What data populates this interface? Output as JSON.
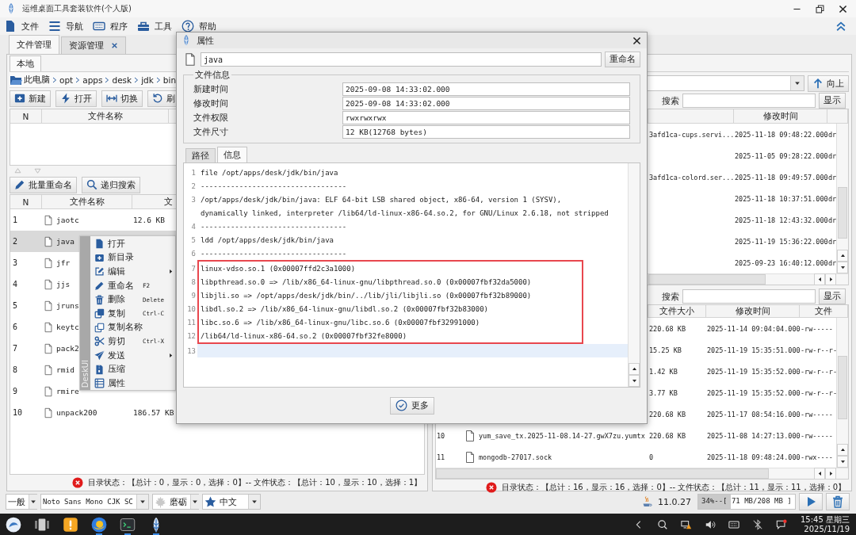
{
  "window": {
    "title": "运维桌面工具套装软件(个人版)"
  },
  "menu": [
    {
      "label": "文件",
      "kind": "docfill"
    },
    {
      "label": "导航",
      "kind": "list"
    },
    {
      "label": "程序",
      "kind": "keyboard"
    },
    {
      "label": "工具",
      "kind": "toolbox"
    },
    {
      "label": "帮助",
      "kind": "help"
    }
  ],
  "left_panel": {
    "tabs": [
      {
        "label": "文件管理",
        "selected": true,
        "closable": false
      },
      {
        "label": "资源管理",
        "selected": false,
        "closable": true
      }
    ],
    "subtabs": [
      {
        "label": "本地",
        "selected": true
      }
    ],
    "breadcrumb": [
      "此电脑",
      "opt",
      "apps",
      "desk",
      "jdk",
      "bin"
    ],
    "toolbar": [
      {
        "label": "新建",
        "kind": "plus"
      },
      {
        "label": "打开",
        "kind": "bolt"
      },
      {
        "label": "切换",
        "kind": "swap"
      },
      {
        "label": "刷",
        "kind": "refresh"
      }
    ],
    "dir_table": {
      "columns": [
        "N",
        "文件名称"
      ]
    },
    "toolbar2": [
      {
        "label": "批量重命名",
        "kind": "pencil"
      },
      {
        "label": "递归搜索",
        "kind": "search"
      }
    ],
    "file_table": {
      "columns": [
        "N",
        "文件名称",
        "文"
      ],
      "rows": [
        {
          "n": "1",
          "name": "jaotc",
          "size": "12.6 KB",
          "selected": false
        },
        {
          "n": "2",
          "name": "java",
          "selected": true
        },
        {
          "n": "3",
          "name": "jfr",
          "selected": false
        },
        {
          "n": "4",
          "name": "jjs",
          "selected": false
        },
        {
          "n": "5",
          "name": "jruns",
          "selected": false
        },
        {
          "n": "6",
          "name": "keytc",
          "selected": false
        },
        {
          "n": "7",
          "name": "pack2",
          "selected": false
        },
        {
          "n": "8",
          "name": "rmid",
          "selected": false
        },
        {
          "n": "9",
          "name": "rmire",
          "selected": false
        },
        {
          "n": "10",
          "name": "unpack200",
          "size": "186.57 KB",
          "selected": false
        }
      ]
    },
    "status": "目录状态：【总计：0，显示：0，选择：0】-- 文件状态：【总计：10，显示：10，选择：1】"
  },
  "right_panel": {
    "up_button": "向上",
    "search": {
      "label": "搜索",
      "button": "显示"
    },
    "dir_table": {
      "columns": [
        "修改时间"
      ],
      "rows": [
        {
          "name": "3afd1ca-cups.servi...",
          "modified": "2025-11-18 09:48:22.000",
          "column_3": "dr"
        },
        {
          "modified": "2025-11-05 09:28:22.000",
          "column_3": "dr"
        },
        {
          "name": "3afd1ca-colord.ser...",
          "modified": "2025-11-18 09:49:57.000",
          "column_3": "dr"
        },
        {
          "modified": "2025-11-18 10:37:51.000",
          "column_3": "dr"
        },
        {
          "modified": "2025-11-18 12:43:32.000",
          "column_3": "dr"
        },
        {
          "modified": "2025-11-19 15:36:22.000",
          "column_3": "dr"
        },
        {
          "modified": "2025-09-23 16:40:12.000",
          "column_3": "dr"
        }
      ]
    },
    "file_search": {
      "label": "搜索",
      "button": "显示"
    },
    "file_table": {
      "columns": [
        "文件大小",
        "修改时间",
        "文件"
      ],
      "rows": [
        {
          "size": "220.68 KB",
          "modified": "2025-11-14 09:04:04.000",
          "permissions": "-rw-----"
        },
        {
          "size": "15.25 KB",
          "modified": "2025-11-19 15:35:51.000",
          "permissions": "-rw-r--r-"
        },
        {
          "size": "1.42 KB",
          "modified": "2025-11-19 15:35:52.000",
          "permissions": "-rw-r--r-"
        },
        {
          "size": "3.77 KB",
          "modified": "2025-11-19 15:35:52.000",
          "permissions": "-rw-r--r-"
        },
        {
          "size": "220.68 KB",
          "modified": "2025-11-17 08:54:16.000",
          "permissions": "-rw-----"
        },
        {
          "n": "10",
          "name": "yum_save_tx.2025-11-08.14-27.gwX7zu.yumtx",
          "size": "220.68 KB",
          "modified": "2025-11-08 14:27:13.000",
          "permissions": "-rw-----"
        },
        {
          "n": "11",
          "name": "mongodb-27017.sock",
          "size": "0",
          "modified": "2025-11-18 09:48:24.000",
          "permissions": "-rwx----"
        }
      ]
    },
    "status": "目录状态：【总计：16，显示：16，选择：0】-- 文件状态：【总计：11，显示：11，选择：0】"
  },
  "bottom_bar": {
    "combos": [
      {
        "label": "一般"
      },
      {
        "label": "Noto Sans Mono CJK SC"
      },
      {
        "label": "磨砺",
        "kind": "leaf"
      },
      {
        "label": "中文",
        "kind": "star"
      }
    ],
    "version": "11.0.27",
    "memory": {
      "text": "34%--[ 71 MB/208 MB ]",
      "level": 0.34
    }
  },
  "taskbar": {
    "apps": [
      {
        "kind": "launcher",
        "running": false
      },
      {
        "kind": "multitask",
        "running": false
      },
      {
        "kind": "files",
        "running": false
      },
      {
        "kind": "browser",
        "running": true
      },
      {
        "kind": "terminal",
        "running": true
      },
      {
        "kind": "app",
        "running": true
      }
    ],
    "tray": [
      {
        "kind": "expand"
      },
      {
        "kind": "search"
      },
      {
        "kind": "network"
      },
      {
        "kind": "volume"
      },
      {
        "kind": "keyboard"
      },
      {
        "kind": "bluetooth"
      },
      {
        "kind": "notify"
      }
    ],
    "time": "15:45 星期三",
    "date": "2025/11/19"
  },
  "context_menu": {
    "side_label": "DeskUI",
    "items": [
      {
        "label": "打开",
        "kind": "docfill",
        "submenu": false
      },
      {
        "label": "新目录",
        "kind": "newdir",
        "submenu": false
      },
      {
        "label": "编辑",
        "kind": "edit",
        "submenu": true
      },
      {
        "label": "重命名",
        "kind": "pencil",
        "shortcut": "F2",
        "submenu": false
      },
      {
        "label": "删除",
        "kind": "trash",
        "shortcut": "Delete",
        "submenu": false
      },
      {
        "label": "复制",
        "kind": "copy",
        "shortcut": "Ctrl-C",
        "submenu": false
      },
      {
        "label": "复制名称",
        "kind": "copyline",
        "submenu": false
      },
      {
        "label": "剪切",
        "kind": "scissors",
        "shortcut": "Ctrl-X",
        "submenu": false
      },
      {
        "label": "发送",
        "kind": "send",
        "submenu": true
      },
      {
        "label": "压缩",
        "kind": "zip",
        "submenu": false
      },
      {
        "label": "属性",
        "kind": "props",
        "submenu": false
      }
    ]
  },
  "dialog": {
    "title": "属性",
    "name": "java",
    "rename_button": "重命名",
    "group_title": "文件信息",
    "fields": [
      {
        "label": "新建时间",
        "value": "2025-09-08 14:33:02.000"
      },
      {
        "label": "修改时间",
        "value": "2025-09-08 14:33:02.000"
      },
      {
        "label": "文件权限",
        "value": "rwxrwxrwx"
      },
      {
        "label": "文件尺寸",
        "value": "12 KB(12768 bytes)"
      }
    ],
    "tabs": [
      {
        "label": "路径",
        "selected": false
      },
      {
        "label": "信息",
        "selected": true
      }
    ],
    "lines": [
      {
        "number": "1",
        "text": "file /opt/apps/desk/jdk/bin/java",
        "current": false
      },
      {
        "number": "2",
        "text": "----------------------------------",
        "current": false
      },
      {
        "number": "3",
        "text": "/opt/apps/desk/jdk/bin/java: ELF 64-bit LSB shared object, x86-64, version 1 (SYSV),",
        "continuation": "dynamically linked, interpreter /lib64/ld-linux-x86-64.so.2, for GNU/Linux 2.6.18, not stripped",
        "current": false
      },
      {
        "number": "4",
        "text": "----------------------------------",
        "current": false
      },
      {
        "number": "5",
        "text": "ldd /opt/apps/desk/jdk/bin/java",
        "current": false
      },
      {
        "number": "6",
        "text": "----------------------------------",
        "current": false
      }
    ],
    "highlighted_lines": [
      {
        "number": "7",
        "text": "linux-vdso.so.1 (0x00007ffd2c3a1000)",
        "current": false
      },
      {
        "number": "8",
        "text": "libpthread.so.0 => /lib/x86_64-linux-gnu/libpthread.so.0 (0x00007fbf32da5000)",
        "current": false
      },
      {
        "number": "9",
        "text": "libjli.so => /opt/apps/desk/jdk/bin/../lib/jli/libjli.so (0x00007fbf32b89000)",
        "current": false
      },
      {
        "number": "10",
        "text": "libdl.so.2 => /lib/x86_64-linux-gnu/libdl.so.2 (0x00007fbf32b83000)",
        "current": false
      },
      {
        "number": "11",
        "text": "libc.so.6 => /lib/x86_64-linux-gnu/libc.so.6 (0x00007fbf32991000)",
        "current": false
      },
      {
        "number": "12",
        "text": "/lib64/ld-linux-x86-64.so.2 (0x00007fbf32fe8000)",
        "current": false
      }
    ],
    "trailing_lines": [
      {
        "number": "13",
        "current": true
      }
    ],
    "more_button": "更多"
  }
}
